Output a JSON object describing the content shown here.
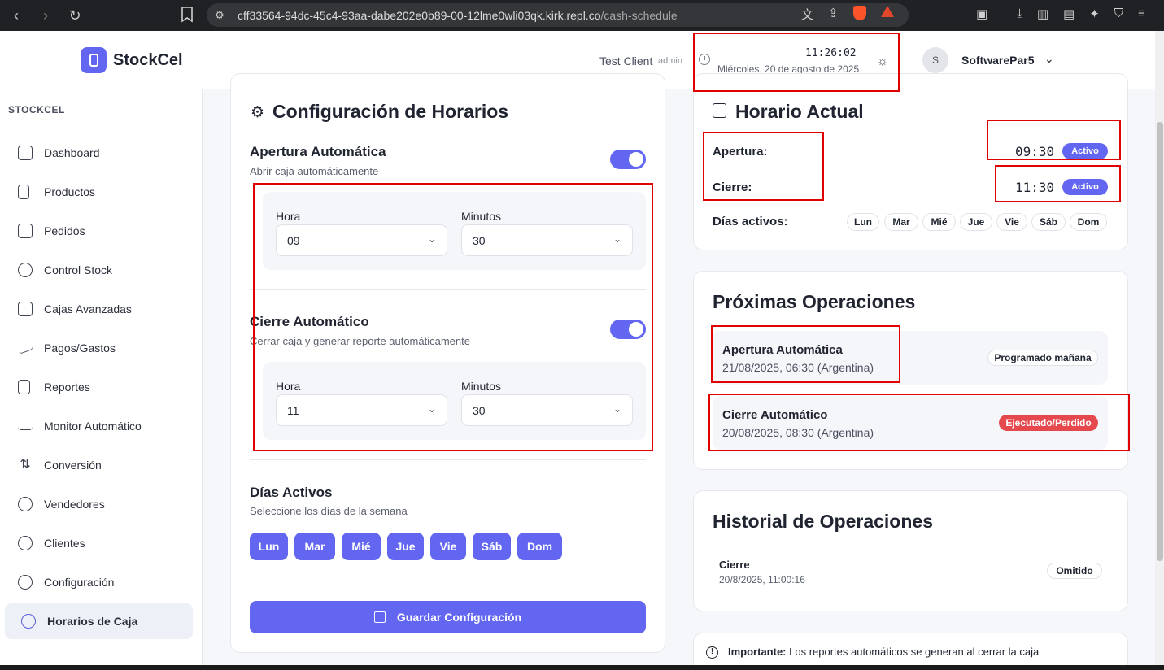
{
  "browser": {
    "url_host": "cff33564-94dc-45c4-93aa-dabe202e0b89-00-12lme0wli03qk.kirk.repl.co",
    "url_path": "/cash-schedule"
  },
  "header": {
    "brand": "StockCel",
    "client_name": "Test Client",
    "client_role": "admin",
    "time": "11:26:02",
    "date": "Miércoles, 20 de agosto de 2025",
    "avatar_initial": "S",
    "user_name": "SoftwarePar5"
  },
  "sidebar": {
    "section": "STOCKCEL",
    "items": [
      {
        "label": "Dashboard"
      },
      {
        "label": "Productos"
      },
      {
        "label": "Pedidos"
      },
      {
        "label": "Control Stock"
      },
      {
        "label": "Cajas Avanzadas"
      },
      {
        "label": "Pagos/Gastos"
      },
      {
        "label": "Reportes"
      },
      {
        "label": "Monitor Automático"
      },
      {
        "label": "Conversión"
      },
      {
        "label": "Vendedores"
      },
      {
        "label": "Clientes"
      },
      {
        "label": "Configuración"
      },
      {
        "label": "Horarios de Caja"
      }
    ]
  },
  "config": {
    "title": "Configuración de Horarios",
    "apertura": {
      "title": "Apertura Automática",
      "desc": "Abrir caja automáticamente",
      "hora_label": "Hora",
      "hora_value": "09",
      "min_label": "Minutos",
      "min_value": "30"
    },
    "cierre": {
      "title": "Cierre Automático",
      "desc": "Cerrar caja y generar reporte automáticamente",
      "hora_label": "Hora",
      "hora_value": "11",
      "min_label": "Minutos",
      "min_value": "30"
    },
    "dias_title": "Días Activos",
    "dias_desc": "Seleccione los días de la semana",
    "days": [
      "Lun",
      "Mar",
      "Mié",
      "Jue",
      "Vie",
      "Sáb",
      "Dom"
    ],
    "save_label": "Guardar Configuración"
  },
  "horario_actual": {
    "title": "Horario Actual",
    "apertura_label": "Apertura:",
    "apertura_time": "09:30",
    "apertura_status": "Activo",
    "cierre_label": "Cierre:",
    "cierre_time": "11:30",
    "cierre_status": "Activo",
    "dias_label": "Días activos:",
    "days": [
      "Lun",
      "Mar",
      "Mié",
      "Jue",
      "Vie",
      "Sáb",
      "Dom"
    ]
  },
  "proximas": {
    "title": "Próximas Operaciones",
    "items": [
      {
        "title": "Apertura Automática",
        "sub": "21/08/2025, 06:30 (Argentina)",
        "status": "Programado mañana"
      },
      {
        "title": "Cierre Automático",
        "sub": "20/08/2025, 08:30 (Argentina)",
        "status": "Ejecutado/Perdido"
      }
    ]
  },
  "historial": {
    "title": "Historial de Operaciones",
    "items": [
      {
        "title": "Cierre",
        "sub": "20/8/2025, 11:00:16",
        "status": "Omitido"
      }
    ]
  },
  "note": {
    "bold": "Importante:",
    "text": "Los reportes automáticos se generan al cerrar la caja"
  },
  "colors": {
    "accent": "#6366f1",
    "danger": "#e5484d",
    "highlight": "#e00000"
  }
}
